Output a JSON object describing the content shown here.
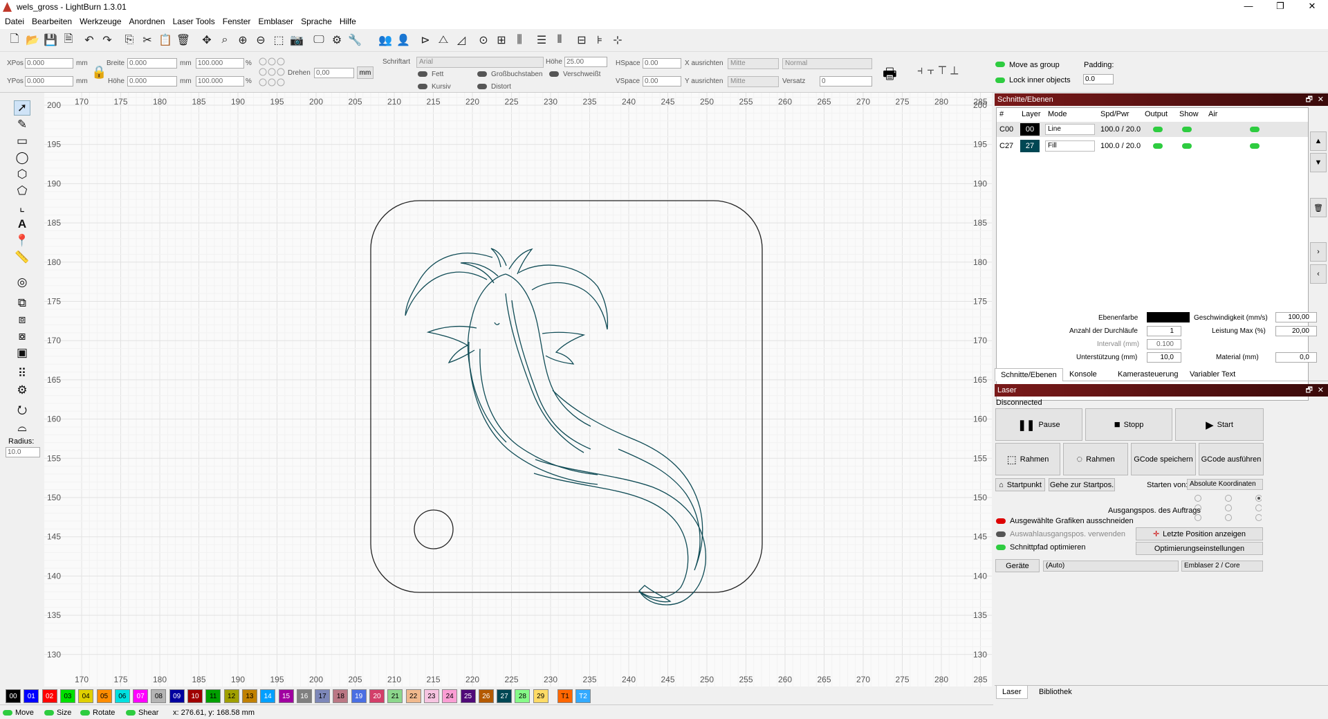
{
  "window": {
    "title": "wels_gross - LightBurn 1.3.01",
    "minimize": "—",
    "maximize": "❐",
    "close": "✕"
  },
  "menu": [
    "Datei",
    "Bearbeiten",
    "Werkzeuge",
    "Anordnen",
    "Laser Tools",
    "Fenster",
    "Emblaser",
    "Sprache",
    "Hilfe"
  ],
  "toolbar_icons": [
    "new-file",
    "open-folder",
    "save",
    "save-as",
    "undo",
    "redo",
    "copy",
    "cut",
    "paste",
    "delete",
    "move",
    "zoom-fit",
    "zoom-in",
    "zoom-out",
    "select-all",
    "camera",
    "monitor",
    "settings",
    "tools",
    "group",
    "user",
    "mirror-h",
    "mirror-v",
    "flip",
    "center",
    "align",
    "distribute",
    "grid1",
    "grid2",
    "grid3",
    "size1",
    "size2"
  ],
  "props": {
    "xpos_label": "XPos",
    "xpos": "0.000",
    "ypos_label": "YPos",
    "ypos": "0.000",
    "unit": "mm",
    "width_label": "Breite",
    "width": "0.000",
    "height_label": "Höhe",
    "height": "0.000",
    "scale_w": "100.000",
    "scale_h": "100.000",
    "pct": "%",
    "rotate_label": "Drehen",
    "rotate": "0,00",
    "mm_btn": "mm",
    "font_label": "Schriftart",
    "font": "Arial",
    "fheight_label": "Höhe",
    "fheight": "25.00",
    "bold": "Fett",
    "italic": "Kursiv",
    "upper": "Großbuchstaben",
    "welded": "Verschweißt",
    "distort": "Distort",
    "hspace_label": "HSpace",
    "hspace": "0.00",
    "vspace_label": "VSpace",
    "vspace": "0.00",
    "xalign_label": "X ausrichten",
    "xalign": "Mitte",
    "yalign_label": "Y ausrichten",
    "yalign": "Mitte",
    "normal": "Normal",
    "offset_label": "Versatz",
    "offset": "0",
    "move_group": "Move as group",
    "lock_inner": "Lock inner objects",
    "padding_label": "Padding:",
    "padding": "0.0"
  },
  "lefttools": [
    "select-arrow",
    "pen",
    "rectangle",
    "ellipse",
    "polygon",
    "edit-nodes",
    "position-tool",
    "text",
    "marker",
    "measure",
    "offset",
    "boolean1",
    "boolean2",
    "boolean3",
    "boolean4",
    "array-grid",
    "array-circle",
    "rotate-tool",
    "node-edit"
  ],
  "radius": {
    "label": "Radius:",
    "value": "10.0"
  },
  "ruler": {
    "x": [
      "170",
      "175",
      "180",
      "185",
      "190",
      "195",
      "200",
      "205",
      "210",
      "215",
      "220",
      "225",
      "230",
      "235",
      "240",
      "245",
      "250",
      "255",
      "260",
      "265",
      "270",
      "275",
      "280",
      "285"
    ],
    "y": [
      "200",
      "195",
      "190",
      "185",
      "180",
      "175",
      "170",
      "165",
      "160",
      "155",
      "150",
      "145",
      "140",
      "135",
      "130"
    ]
  },
  "palette": [
    {
      "n": "00",
      "c": "#000000",
      "t": "#ffffff"
    },
    {
      "n": "01",
      "c": "#0000ff",
      "t": "#ffffff"
    },
    {
      "n": "02",
      "c": "#ff0000",
      "t": "#ffffff"
    },
    {
      "n": "03",
      "c": "#00e000",
      "t": "#000000"
    },
    {
      "n": "04",
      "c": "#e0d000",
      "t": "#000000"
    },
    {
      "n": "05",
      "c": "#ff8c00",
      "t": "#000000"
    },
    {
      "n": "06",
      "c": "#00e0e0",
      "t": "#000000"
    },
    {
      "n": "07",
      "c": "#ff00ff",
      "t": "#ffffff"
    },
    {
      "n": "08",
      "c": "#b4b4b4",
      "t": "#000000"
    },
    {
      "n": "09",
      "c": "#0000a0",
      "t": "#ffffff"
    },
    {
      "n": "10",
      "c": "#a00000",
      "t": "#ffffff"
    },
    {
      "n": "11",
      "c": "#00a000",
      "t": "#000000"
    },
    {
      "n": "12",
      "c": "#a0a000",
      "t": "#000000"
    },
    {
      "n": "13",
      "c": "#c08000",
      "t": "#000000"
    },
    {
      "n": "14",
      "c": "#00a0ff",
      "t": "#ffffff"
    },
    {
      "n": "15",
      "c": "#a000a0",
      "t": "#ffffff"
    },
    {
      "n": "16",
      "c": "#808080",
      "t": "#ffffff"
    },
    {
      "n": "17",
      "c": "#7d87b9",
      "t": "#000000"
    },
    {
      "n": "18",
      "c": "#bb7784",
      "t": "#000000"
    },
    {
      "n": "19",
      "c": "#4a6fe3",
      "t": "#ffffff"
    },
    {
      "n": "20",
      "c": "#d33f6a",
      "t": "#ffffff"
    },
    {
      "n": "21",
      "c": "#8cd78c",
      "t": "#000000"
    },
    {
      "n": "22",
      "c": "#f0b98d",
      "t": "#000000"
    },
    {
      "n": "23",
      "c": "#f6c4e1",
      "t": "#000000"
    },
    {
      "n": "24",
      "c": "#fa9ed4",
      "t": "#000000"
    },
    {
      "n": "25",
      "c": "#500a78",
      "t": "#ffffff"
    },
    {
      "n": "26",
      "c": "#b45a00",
      "t": "#ffffff"
    },
    {
      "n": "27",
      "c": "#004754",
      "t": "#ffffff"
    },
    {
      "n": "28",
      "c": "#86fa88",
      "t": "#000000"
    },
    {
      "n": "29",
      "c": "#ffdb66",
      "t": "#000000"
    },
    {
      "n": "T1",
      "c": "#ff6600",
      "t": "#000000"
    },
    {
      "n": "T2",
      "c": "#33aaff",
      "t": "#ffffff"
    }
  ],
  "status": {
    "move": "Move",
    "size": "Size",
    "rotate": "Rotate",
    "shear": "Shear",
    "coords": "x: 276.61, y: 168.58 mm"
  },
  "cuts": {
    "title": "Schnitte/Ebenen",
    "headers": [
      "#",
      "Layer",
      "Mode",
      "Spd/Pwr",
      "Output",
      "Show",
      "Air"
    ],
    "rows": [
      {
        "id": "C00",
        "layer": "00",
        "color": "#000000",
        "mode": "Line",
        "spdpwr": "100.0 / 20.0"
      },
      {
        "id": "C27",
        "layer": "27",
        "color": "#004754",
        "mode": "Fill",
        "spdpwr": "100.0 / 20.0"
      }
    ],
    "layer_color_label": "Ebenenfarbe",
    "layer_color": "#000000",
    "passes_label": "Anzahl der Durchläufe",
    "passes": "1",
    "interval_label": "Intervall (mm)",
    "interval": "0.100",
    "support_label": "Unterstützung (mm)",
    "support": "10,0",
    "speed_label": "Geschwindigkeit (mm/s)",
    "speed": "100,00",
    "power_label": "Leistung Max (%)",
    "power": "20,00",
    "material_label": "Material (mm)",
    "material": "0,0",
    "tabs": [
      "Schnitte/Ebenen",
      "Konsole",
      "Kamerasteuerung",
      "Variabler Text"
    ]
  },
  "laser": {
    "title": "Laser",
    "status": "Disconnected",
    "pause": "Pause",
    "stop": "Stopp",
    "start": "Start",
    "frame1": "Rahmen",
    "frame2": "Rahmen",
    "save_gcode": "GCode speichern",
    "run_gcode": "GCode ausführen",
    "home": "Startpunkt",
    "goto": "Gehe zur Startpos.",
    "start_from_label": "Starten von:",
    "start_from": "Absolute Koordinaten",
    "job_origin": "Ausgangspos. des Auftrags",
    "cut_selected": "Ausgewählte Grafiken ausschneiden",
    "use_selection": "Auswahlausgangspos. verwenden",
    "optimize": "Schnittpfad optimieren",
    "show_last": "Letzte Position anzeigen",
    "opt_settings": "Optimierungseinstellungen",
    "devices": "Geräte",
    "port": "(Auto)",
    "device": "Emblaser 2 / Core",
    "tabs": [
      "Laser",
      "Bibliothek"
    ]
  }
}
